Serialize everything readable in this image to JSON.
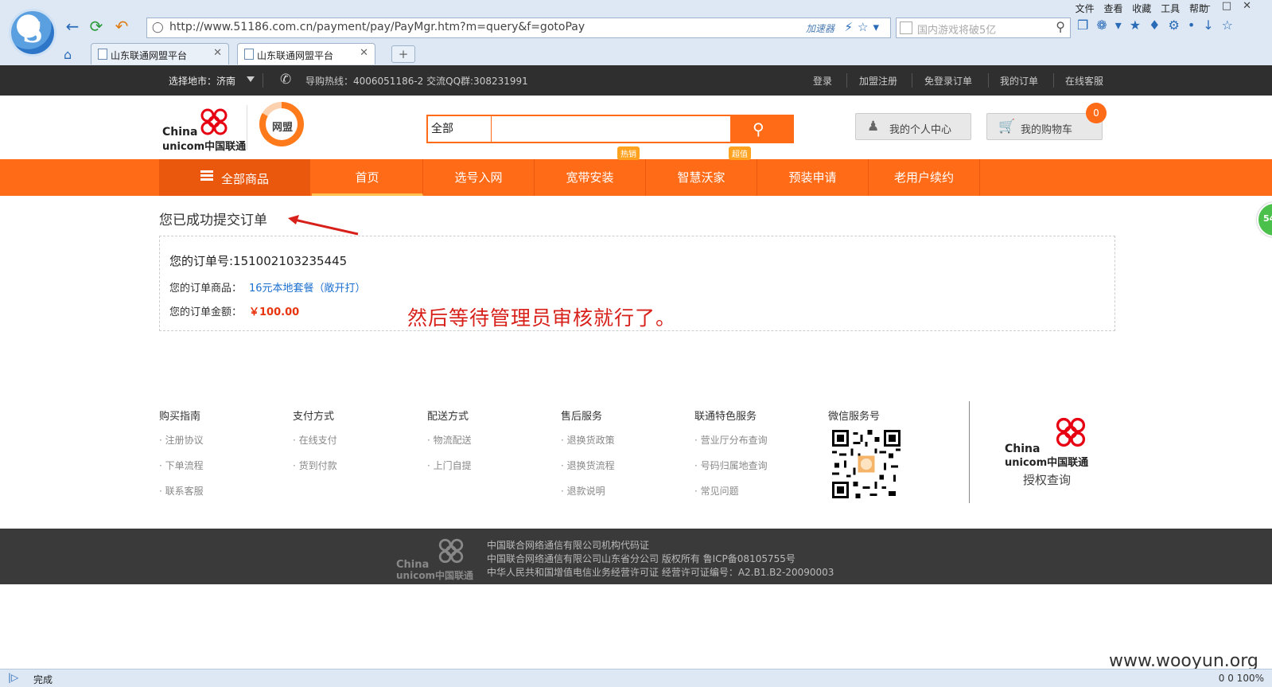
{
  "browser": {
    "menu": [
      "文件",
      "查看",
      "收藏",
      "工具",
      "帮助"
    ],
    "url": "http://www.51186.com.cn/payment/pay/PayMgr.htm?m=query&f=gotoPay",
    "accelerator_label": "加速器",
    "search_placeholder": "国内游戏将破5亿",
    "tabs": [
      {
        "title": "山东联通网盟平台",
        "active": false
      },
      {
        "title": "山东联通网盟平台",
        "active": true
      }
    ],
    "status_text": "完成",
    "status_right": "0    0    100%"
  },
  "topbar": {
    "city": "选择地市：济南",
    "hotline": "导购热线：4006051186-2  交流QQ群:308231991",
    "links": [
      "登录",
      "加盟注册",
      "免登录订单",
      "我的订单",
      "在线客服"
    ]
  },
  "header": {
    "brand_china": "China",
    "brand_unicom": "unicom中国联通",
    "wangmeng": "网盟",
    "search_category": "全部",
    "personal_center": "我的个人中心",
    "cart": "我的购物车",
    "cart_count": "0"
  },
  "nav": {
    "all": "全部商品",
    "items": [
      "首页",
      "选号入网",
      "宽带安装",
      "智慧沃家",
      "预装申请",
      "老用户续约"
    ],
    "active_index": 0,
    "tag_hot": "热销",
    "tag_value": "超值"
  },
  "order": {
    "success_title": "您已成功提交订单",
    "order_no": "您的订单号:151002103235445",
    "product_label": "您的订单商品：",
    "product": "16元本地套餐（敞开打）",
    "amount_label": "您的订单金额：",
    "amount": "￥100.00"
  },
  "annotation": "然后等待管理员审核就行了。",
  "footer": {
    "columns": [
      {
        "title": "购买指南",
        "links": [
          "注册协议",
          "下单流程",
          "联系客服"
        ]
      },
      {
        "title": "支付方式",
        "links": [
          "在线支付",
          "货到付款"
        ]
      },
      {
        "title": "配送方式",
        "links": [
          "物流配送",
          "上门自提"
        ]
      },
      {
        "title": "售后服务",
        "links": [
          "退换货政策",
          "退换货流程",
          "退款说明"
        ]
      },
      {
        "title": "联通特色服务",
        "links": [
          "营业厅分布查询",
          "号码归属地查询",
          "常见问题"
        ]
      }
    ],
    "wechat_title": "微信服务号",
    "auth_label": "授权查询",
    "bottom_lines": [
      "中国联合网络通信有限公司机构代码证",
      "中国联合网络通信有限公司山东省分公司 版权所有 鲁ICP备08105755号",
      "中华人民共和国增值电信业务经营许可证 经营许可证编号：A2.B1.B2-20090003"
    ]
  },
  "watermark": "www.wooyun.org",
  "float_badge": "54",
  "colors": {
    "brand_orange": "#ff6b17",
    "link_blue": "#1a6fcf",
    "price_red": "#e8340e",
    "annotation_red": "#d8201a"
  }
}
